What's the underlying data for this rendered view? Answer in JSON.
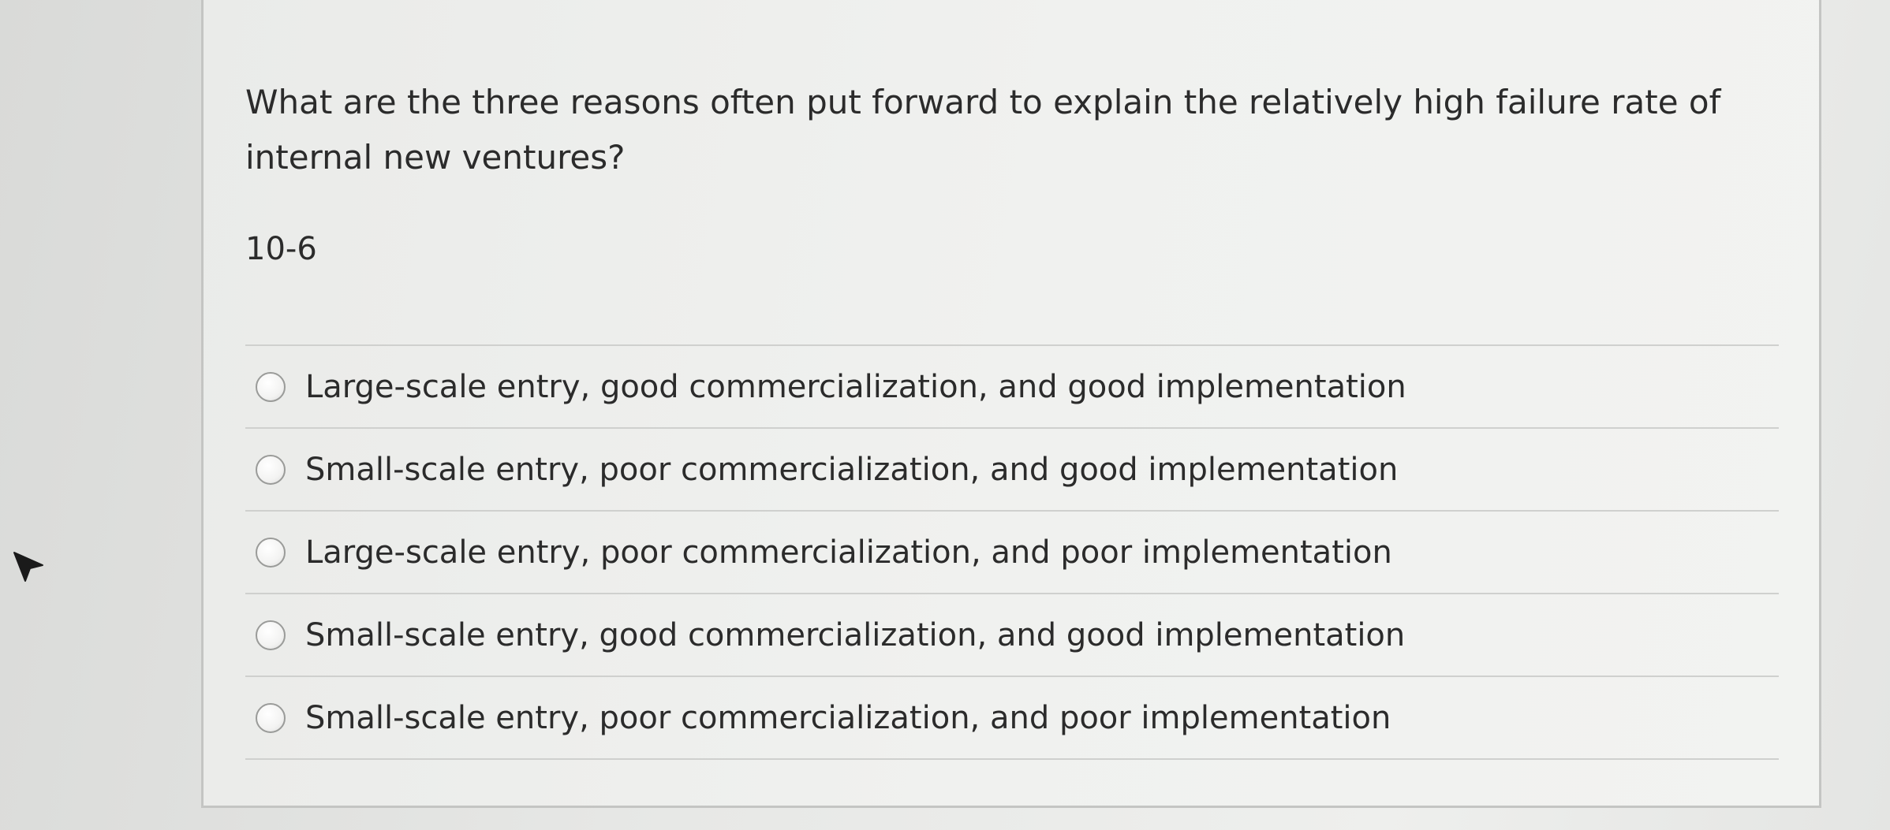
{
  "question": {
    "text": "What are the three reasons often put forward to explain the relatively high failure rate of internal new ventures?",
    "code": "10-6"
  },
  "answers": [
    {
      "label": "Large-scale entry, good commercialization, and good implementation",
      "selected": false
    },
    {
      "label": "Small-scale entry, poor commercialization, and good implementation",
      "selected": false
    },
    {
      "label": "Large-scale entry, poor commercialization, and poor implementation",
      "selected": false
    },
    {
      "label": "Small-scale entry, good commercialization, and good implementation",
      "selected": false
    },
    {
      "label": "Small-scale entry, poor commercialization, and poor implementation",
      "selected": false
    }
  ],
  "icons": {
    "cursor": "mouse-pointer-icon",
    "radio": "radio-button-icon"
  },
  "colors": {
    "text": "#2b2b2b",
    "card_border": "#c4c5c3",
    "divider": "#cfd0ce",
    "radio_border": "#9a9b99"
  }
}
